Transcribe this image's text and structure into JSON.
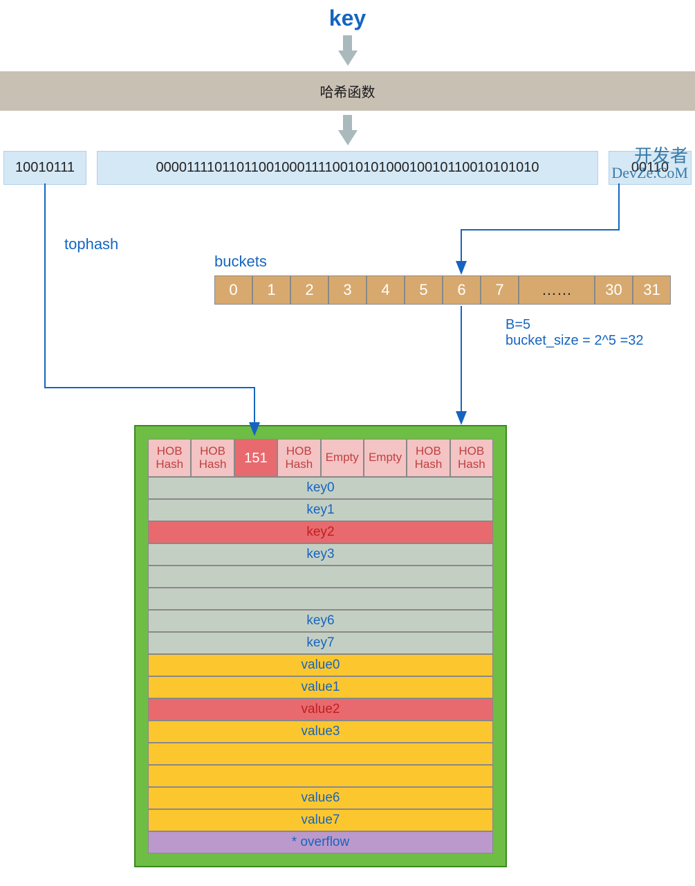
{
  "title": "key",
  "hash_func": "哈希函数",
  "hash": {
    "high": "10010111",
    "mid": "000011110110110010001111001010100010010110010101010",
    "low": "00110"
  },
  "labels": {
    "tophash": "tophash",
    "buckets": "buckets"
  },
  "buckets": [
    "0",
    "1",
    "2",
    "3",
    "4",
    "5",
    "6",
    "7",
    "……",
    "30",
    "31"
  ],
  "info": {
    "b": "B=5",
    "size": "bucket_size = 2^5 =32"
  },
  "tophash_cells": [
    "HOB Hash",
    "HOB Hash",
    "151",
    "HOB Hash",
    "Empty",
    "Empty",
    "HOB Hash",
    "HOB Hash"
  ],
  "keys": [
    "key0",
    "key1",
    "key2",
    "key3",
    "",
    "",
    "key6",
    "key7"
  ],
  "values": [
    "value0",
    "value1",
    "value2",
    "value3",
    "",
    "",
    "value6",
    "value7"
  ],
  "overflow": "* overflow",
  "watermark": {
    "line1": "开发者",
    "line2": "DevZe.CoM"
  }
}
